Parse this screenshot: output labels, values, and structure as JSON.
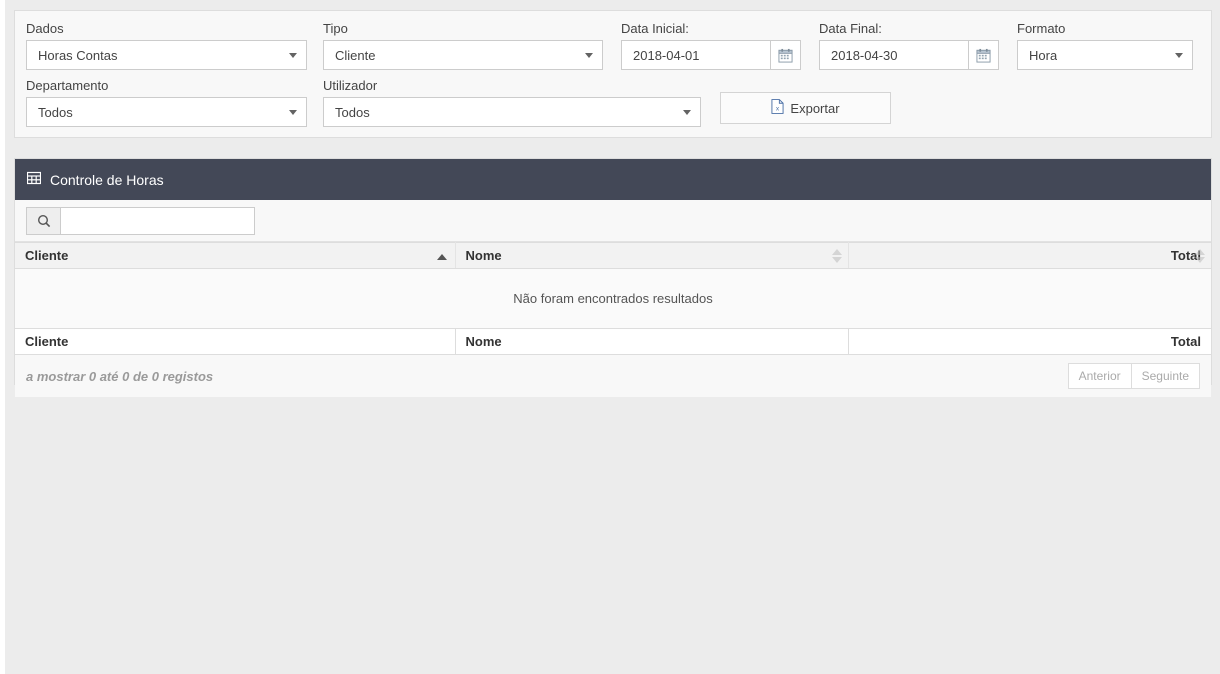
{
  "filters": {
    "dados": {
      "label": "Dados",
      "value": "Horas Contas",
      "icon": "chevron-down-icon"
    },
    "tipo": {
      "label": "Tipo",
      "value": "Cliente",
      "icon": "chevron-down-icon"
    },
    "data_inicial": {
      "label": "Data Inicial:",
      "value": "2018-04-01",
      "placeholder": "",
      "icon": "calendar-icon"
    },
    "data_final": {
      "label": "Data Final:",
      "value": "2018-04-30",
      "placeholder": "",
      "icon": "calendar-icon"
    },
    "formato": {
      "label": "Formato",
      "value": "Hora",
      "icon": "chevron-down-icon"
    },
    "departamento": {
      "label": "Departamento",
      "value": "Todos",
      "icon": "chevron-down-icon"
    },
    "utilizador": {
      "label": "Utilizador",
      "value": "Todos",
      "icon": "chevron-down-icon"
    },
    "export_button": {
      "label": "Exportar",
      "icon": "file-excel-icon"
    }
  },
  "panel": {
    "title": "Controle de Horas",
    "icon": "table-grid-icon"
  },
  "search": {
    "icon": "search-icon",
    "value": "",
    "placeholder": ""
  },
  "table": {
    "columns": [
      {
        "label": "Cliente",
        "sort": "asc",
        "align": "left"
      },
      {
        "label": "Nome",
        "sort": "none",
        "align": "left"
      },
      {
        "label": "Total",
        "sort": "none",
        "align": "right"
      }
    ],
    "rows": [],
    "empty_message": "Não foram encontrados resultados",
    "footer_columns": [
      "Cliente",
      "Nome",
      "Total"
    ]
  },
  "footer": {
    "info": "a mostrar 0 até 0 de 0 registos",
    "prev_label": "Anterior",
    "next_label": "Seguinte"
  },
  "colors": {
    "panel_header_bg": "#434857",
    "page_bg": "#ececec",
    "panel_bg": "#f8f8f8",
    "border": "#dddddd"
  }
}
